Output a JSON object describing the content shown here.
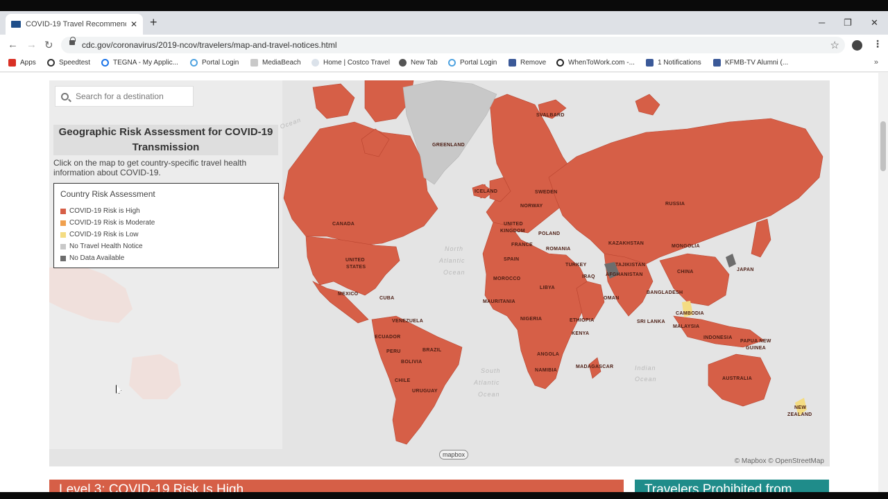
{
  "browser": {
    "tab_title": "COVID-19 Travel Recommendatio",
    "url": "cdc.gov/coronavirus/2019-ncov/travelers/map-and-travel-notices.html",
    "bookmarks": [
      {
        "label": "Apps",
        "icon": "apps-grid-icon",
        "color": "#d93025"
      },
      {
        "label": "Speedtest",
        "icon": "speedometer-icon",
        "color": "#333333"
      },
      {
        "label": "TEGNA - My Applic...",
        "icon": "tegna-icon",
        "color": "#1a73e8"
      },
      {
        "label": "Portal Login",
        "icon": "portal-icon",
        "color": "#4fa3e0"
      },
      {
        "label": "MediaBeach",
        "icon": "mediabeach-icon",
        "color": "#8a8a8a"
      },
      {
        "label": "Home | Costco Travel",
        "icon": "costco-icon",
        "color": "#9aa7b8"
      },
      {
        "label": "New Tab",
        "icon": "globe-icon",
        "color": "#555555"
      },
      {
        "label": "Portal Login",
        "icon": "portal-icon",
        "color": "#4fa3e0"
      },
      {
        "label": "Remove",
        "icon": "facebook-icon",
        "color": "#3b5998"
      },
      {
        "label": "WhenToWork.com -...",
        "icon": "wikipedia-icon",
        "color": "#222222"
      },
      {
        "label": "1 Notifications",
        "icon": "facebook-icon",
        "color": "#3b5998"
      },
      {
        "label": "KFMB-TV Alumni (...",
        "icon": "facebook-icon",
        "color": "#3b5998"
      }
    ]
  },
  "page": {
    "search_placeholder": "Search for a destination",
    "title": "Geographic Risk Assessment for COVID-19 Transmission",
    "instruction": "Click on the map to get country-specific travel health information about COVID-19.",
    "legend": {
      "title": "Country Risk Assessment",
      "items": [
        {
          "label": "COVID-19 Risk is High",
          "color": "#d65f47"
        },
        {
          "label": "COVID-19 Risk is Moderate",
          "color": "#f0a04e"
        },
        {
          "label": "COVID-19 Risk is Low",
          "color": "#f4dc82"
        },
        {
          "label": "No Travel Health Notice",
          "color": "#c8c8c8"
        },
        {
          "label": "No Data Available",
          "color": "#6d6d6d"
        }
      ]
    },
    "map": {
      "attribution": "© Mapbox © OpenStreetMap",
      "mapbox_logo": "mapbox",
      "country_labels": [
        "SVALBARD",
        "GREENLAND",
        "ICELAND",
        "SWEDEN",
        "NORWAY",
        "UNITED",
        "KINGDOM",
        "POLAND",
        "FRANCE",
        "ROMANIA",
        "RUSSIA",
        "KAZAKHSTAN",
        "MONGOLIA",
        "TAJIKISTAN",
        "AFGHANISTAN",
        "TURKEY",
        "CHINA",
        "JAPAN",
        "SPAIN",
        "MOROCCO",
        "LIBYA",
        "IRAQ",
        "OMAN",
        "BANGLADESH",
        "CAMBODIA",
        "SRI LANKA",
        "MALAYSIA",
        "INDONESIA",
        "PAPUA NEW",
        "GUINEA",
        "MAURITANIA",
        "NIGERIA",
        "ETHIOPIA",
        "KENYA",
        "ANGOLA",
        "NAMIBIA",
        "MADAGASCAR",
        "CANADA",
        "UNITED",
        "STATES",
        "MEXICO",
        "CUBA",
        "VENEZUELA",
        "ECUADOR",
        "PERU",
        "BRAZIL",
        "BOLIVIA",
        "CHILE",
        "URUGUAY",
        "AUSTRALIA",
        "NEW",
        "ZEALAND"
      ],
      "ocean_labels": [
        "North",
        "Atlantic",
        "Ocean",
        "South",
        "Atlantic",
        "Ocean",
        "Indian",
        "Ocean",
        "Ocean"
      ]
    },
    "banners": [
      {
        "text": "Level 3: COVID-19 Risk Is High",
        "color": "#d65f47"
      },
      {
        "text": "Travelers Prohibited from",
        "color": "#1f8c8a"
      }
    ],
    "colors": {
      "high_risk": "#d65f47",
      "no_notice": "#c8c8c8",
      "no_data": "#6d6d6d",
      "low": "#f4dc82"
    }
  }
}
